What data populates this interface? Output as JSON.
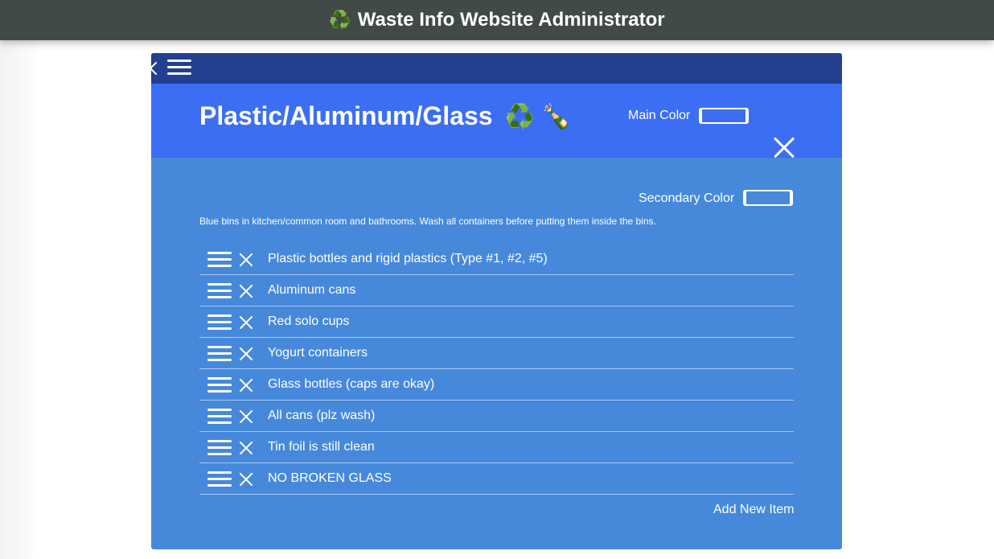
{
  "app": {
    "logo_glyph": "♻️",
    "title": "Waste Info Website Administrator"
  },
  "category": {
    "title": "Plastic/Aluminum/Glass",
    "title_emoji": "♻️ 🍾",
    "main_color_label": "Main Color",
    "main_color": "#3b6ef3",
    "secondary_color_label": "Secondary Color",
    "secondary_color": "#4689db",
    "description": "Blue bins in kitchen/common room and bathrooms. Wash all containers before putting them inside the bins.",
    "items": [
      {
        "label": "Plastic bottles and rigid plastics (Type #1, #2, #5)"
      },
      {
        "label": "Aluminum cans"
      },
      {
        "label": "Red solo cups"
      },
      {
        "label": "Yogurt containers"
      },
      {
        "label": "Glass bottles (caps are okay)"
      },
      {
        "label": "All cans (plz wash)"
      },
      {
        "label": "Tin foil is still clean"
      },
      {
        "label": "NO BROKEN GLASS"
      }
    ],
    "add_item_label": "Add New Item"
  },
  "icons": {
    "menu": "hamburger-menu-icon",
    "close": "close-icon",
    "drag": "drag-handle-icon",
    "delete": "delete-x-icon"
  }
}
